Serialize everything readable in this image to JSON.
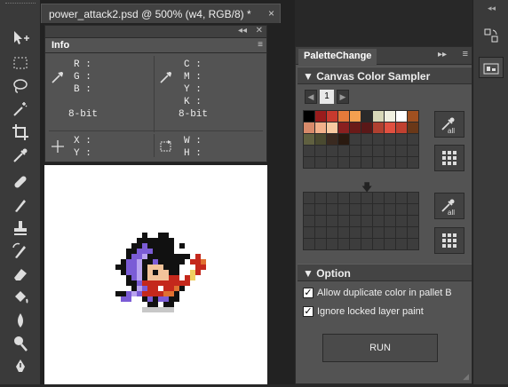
{
  "document": {
    "tab_title": "power_attack2.psd @ 500% (w4, RGB/8) *",
    "close_glyph": "×"
  },
  "info": {
    "tab_label": "Info",
    "rgb_labels": [
      "R :",
      "G :",
      "B :"
    ],
    "cmyk_labels": [
      "C :",
      "M :",
      "Y :",
      "K :"
    ],
    "bit_left": "8-bit",
    "bit_right": "8-bit",
    "xy_labels": [
      "X :",
      "Y :"
    ],
    "wh_labels": [
      "W :",
      "H :"
    ]
  },
  "palette": {
    "tab_label": "PaletteChange",
    "sampler_title": "Canvas Color Sampler",
    "page_number": "1",
    "swatches": [
      "#000000",
      "#9a1c1c",
      "#c73a2e",
      "#e57a3a",
      "#f4a050",
      "#2a2a2a",
      "#d8d8b8",
      "#f0f0e0",
      "#ffffff",
      "#a05020",
      "#d88a6a",
      "#f2b08a",
      "#f7c9a0",
      "#8a2020",
      "#6a1a18",
      "#5a1818",
      "#b04030",
      "#e05040",
      "#c04030",
      "#6a3818",
      "#606040",
      "#4a4a30",
      "#3a2a20",
      "#2a1a10"
    ],
    "option_title": "Option",
    "options": [
      {
        "label": "Allow duplicate color in pallet B",
        "checked": true
      },
      {
        "label": "Ignore locked layer paint",
        "checked": true
      }
    ],
    "run_label": "RUN",
    "all_label": "all"
  },
  "tools": [
    "move-tool",
    "marquee-tool",
    "lasso-tool",
    "magic-wand-tool",
    "crop-tool",
    "eyedropper-tool",
    "healing-tool",
    "brush-tool",
    "stamp-tool",
    "history-brush-tool",
    "eraser-tool",
    "paint-bucket-tool",
    "blur-tool",
    "dodge-tool",
    "pen-tool"
  ],
  "colors": {
    "accent": "#c73a2e"
  }
}
